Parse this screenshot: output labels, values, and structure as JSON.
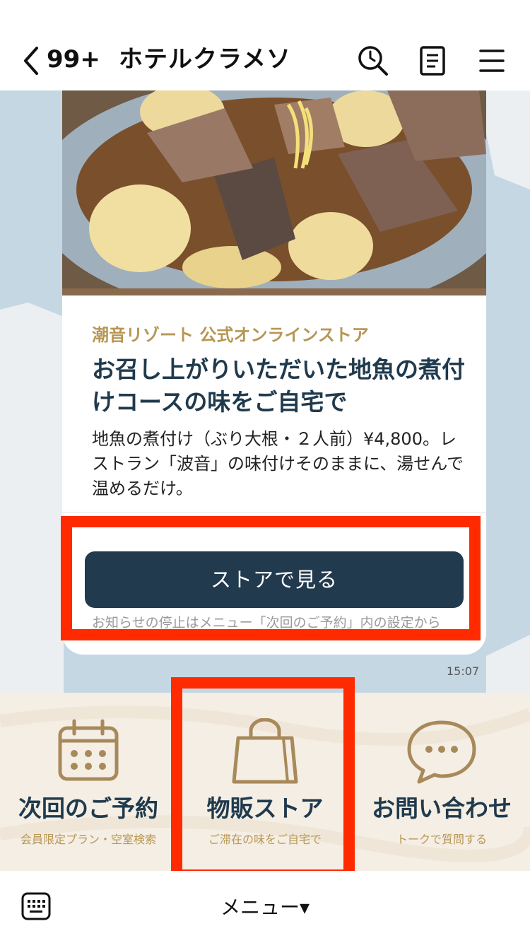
{
  "header": {
    "unread_count": "99+",
    "title": "ホテルクラメソ"
  },
  "message": {
    "store_name": "潮音リゾート 公式オンラインストア",
    "headline": "お召し上がりいただいた地魚の煮付けコースの味をご自宅で",
    "body": "地魚の煮付け（ぶり大根・２人前）¥4,800。レストラン「波音」の味付けそのままに、湯せんで温めるだけ。",
    "cta_label": "ストアで見る",
    "notice": "お知らせの停止はメニュー「次回のご予約」内の設定から",
    "time": "15:07"
  },
  "rich_menu": {
    "items": [
      {
        "label": "次回のご予約",
        "sub": "会員限定プラン・空室検索",
        "icon": "calendar-icon"
      },
      {
        "label": "物販ストア",
        "sub": "ご滞在の味をご自宅で",
        "icon": "shopping-bag-icon"
      },
      {
        "label": "お問い合わせ",
        "sub": "トークで質問する",
        "icon": "speech-bubble-icon"
      }
    ]
  },
  "bottom_bar": {
    "menu_label": "メニュー▾"
  },
  "colors": {
    "accent_gold": "#b79654",
    "navy": "#223a4e",
    "highlight": "#ff2a00",
    "chat_bg": "#c6d7e4"
  }
}
